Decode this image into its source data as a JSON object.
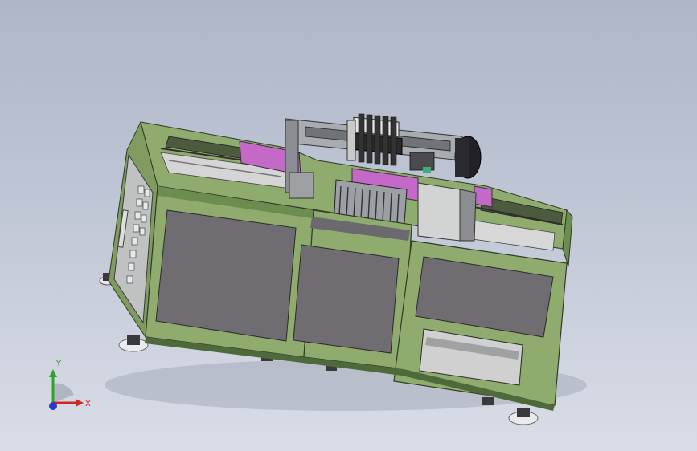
{
  "viewport": {
    "background_top": "#aeb6c8",
    "background_bottom": "#d9dde6"
  },
  "machine": {
    "frame_color": "#8fac6e",
    "frame_dark": "#5f7d47",
    "panel_color": "#6f6c72",
    "panel_light": "#cfd0cf",
    "accent_color": "#c469c8",
    "steel_color": "#b9bcc0",
    "dark_part": "#2b2b2f"
  },
  "triad": {
    "x_label": "X",
    "y_label": "Y",
    "x_color": "#d22525",
    "y_color": "#2aa52a",
    "z_color": "#2a37c9"
  }
}
